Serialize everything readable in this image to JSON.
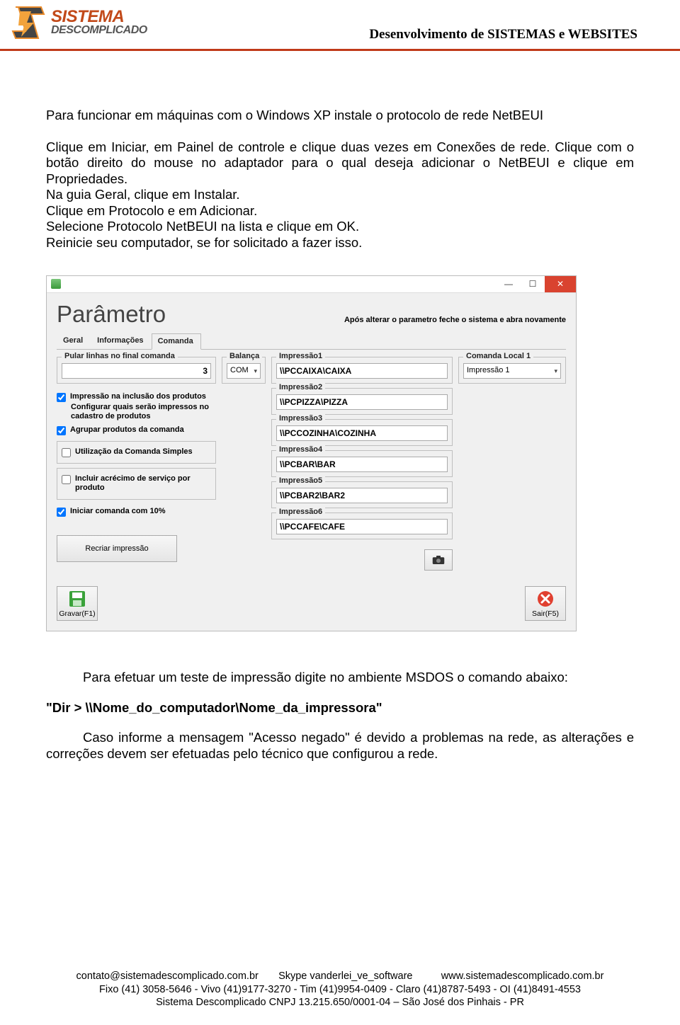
{
  "header": {
    "logo_line1": "SISTEMA",
    "logo_line2": "DESCOMPLICADO",
    "tagline": "Desenvolvimento de SISTEMAS e WEBSITES"
  },
  "intro": {
    "p1": "Para funcionar em máquinas com o Windows XP instale o protocolo de rede NetBEUI",
    "p2": "Clique em Iniciar, em Painel de controle e clique duas vezes em Conexões de rede. Clique com o botão direito do mouse no adaptador para o qual deseja adicionar o NetBEUI e clique em Propriedades.",
    "p3": "Na guia Geral, clique em Instalar.",
    "p4": "Clique em Protocolo e em Adicionar.",
    "p5": "Selecione Protocolo NetBEUI na lista e clique em OK.",
    "p6": "Reinicie seu computador, se for solicitado a fazer isso."
  },
  "app": {
    "title": "Parâmetro",
    "top_note": "Após alterar o parametro feche o sistema e abra novamente",
    "tabs": [
      "Geral",
      "Informações",
      "Comanda"
    ],
    "active_tab": 2,
    "col1": {
      "pular_label": "Pular linhas no final comanda",
      "pular_value": "3",
      "balanca_label": "Balança",
      "balanca_value": "COM",
      "chk1": "Impressão na inclusão dos produtos",
      "chk1_sub": "Configurar quais serão impressos no cadastro de produtos",
      "chk2": "Agrupar produtos da comanda",
      "chk3": "Utilização da Comanda Simples",
      "chk4": "Incluir acrécimo de serviço por produto",
      "chk5": "Iniciar comanda com 10%",
      "btn_recriar": "Recriar impressão"
    },
    "col3": {
      "items": [
        {
          "label": "Impressão1",
          "value": "\\\\PCCAIXA\\CAIXA"
        },
        {
          "label": "Impressão2",
          "value": "\\\\PCPIZZA\\PIZZA"
        },
        {
          "label": "Impressão3",
          "value": "\\\\PCCOZINHA\\COZINHA"
        },
        {
          "label": "Impressão4",
          "value": "\\\\PCBAR\\BAR"
        },
        {
          "label": "Impressão5",
          "value": "\\\\PCBAR2\\BAR2"
        },
        {
          "label": "Impressão6",
          "value": "\\\\PCCAFE\\CAFE"
        }
      ]
    },
    "col4": {
      "label": "Comanda Local 1",
      "value": "Impressão 1"
    },
    "bottom": {
      "gravar": "Gravar(F1)",
      "sair": "Sair(F5)"
    }
  },
  "post": {
    "p1": "Para efetuar um teste de impressão digite no ambiente MSDOS o comando abaixo:",
    "cmd": "\"Dir > \\\\Nome_do_computador\\Nome_da_impressora\"",
    "p2": "Caso informe a mensagem \"Acesso negado\" é devido a problemas na rede, as alterações e correções devem ser efetuadas pelo técnico que configurou a rede."
  },
  "footer": {
    "l1_left": "contato@sistemadescomplicado.com.br",
    "l1_mid": "Skype vanderlei_ve_software",
    "l1_right": "www.sistemadescomplicado.com.br",
    "l2": "Fixo (41) 3058-5646 - Vivo (41)9177-3270 - Tim (41)9954-0409 - Claro (41)8787-5493 - OI (41)8491-4553",
    "l3": "Sistema Descomplicado CNPJ 13.215.650/0001-04 – São José dos Pinhais - PR"
  }
}
